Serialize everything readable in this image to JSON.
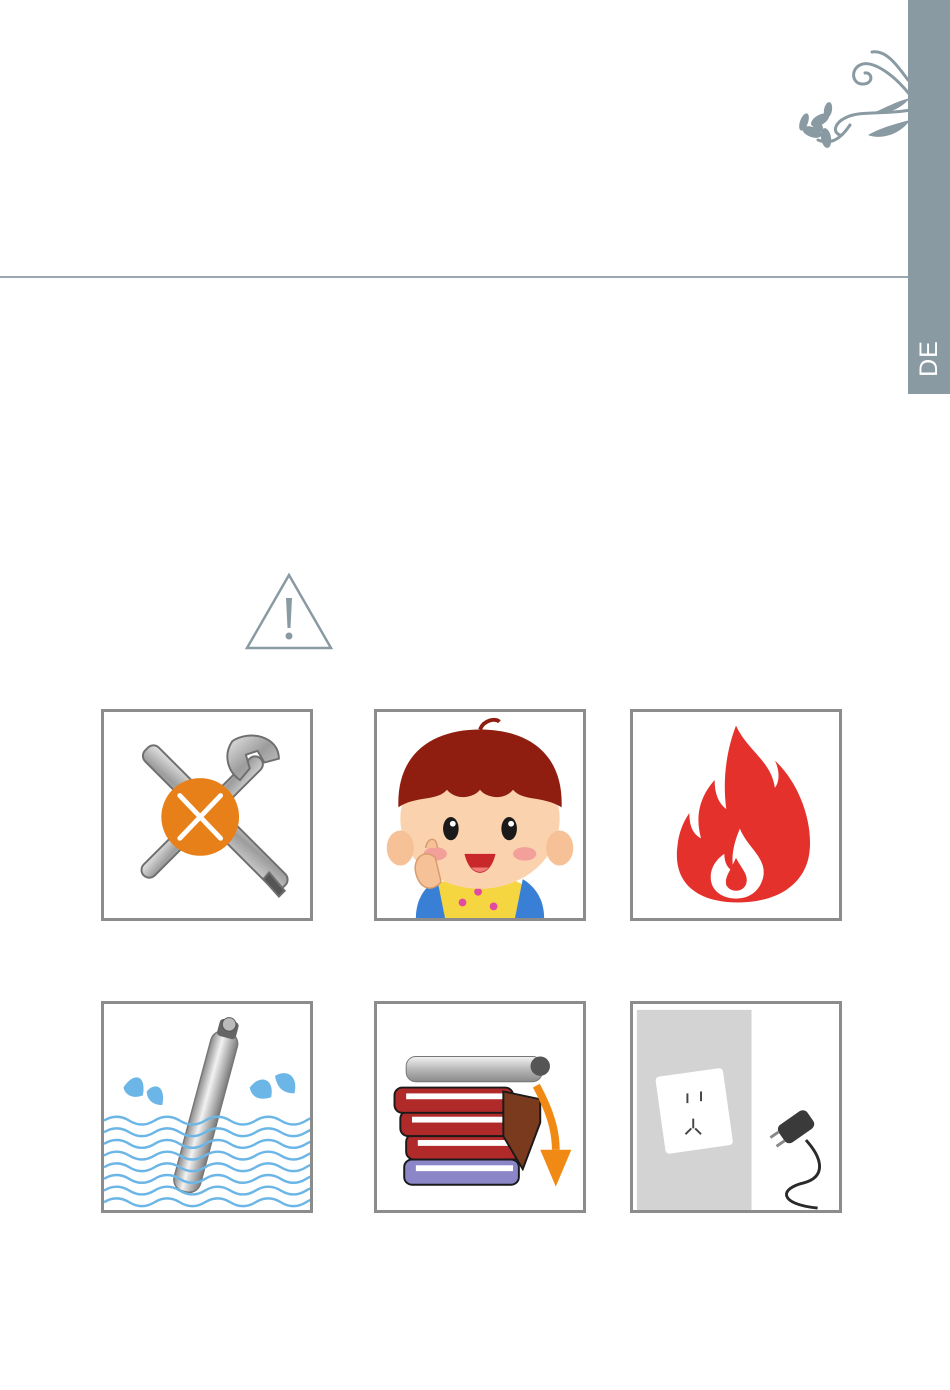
{
  "side_tab": {
    "language_code": "DE",
    "color": "#8a9aa3"
  },
  "icons": {
    "warning": "warning-triangle-icon",
    "row1": [
      "no-disassembly-tools-icon",
      "keep-away-from-children-icon",
      "flammable-fire-icon"
    ],
    "row2": [
      "no-water-immersion-icon",
      "do-not-drop-icon",
      "unplug-power-icon"
    ]
  },
  "colors": {
    "orange_x": "#e8801a",
    "fire_red": "#e4312b",
    "water_blue": "#6bb6e6"
  }
}
